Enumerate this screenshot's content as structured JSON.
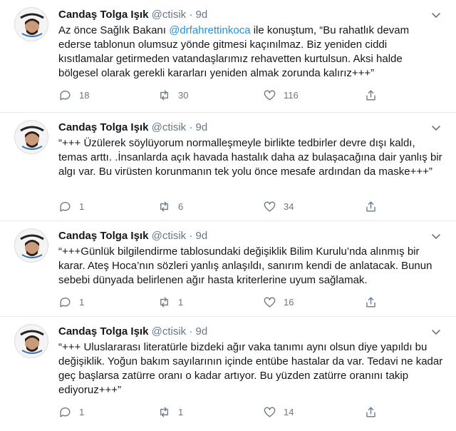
{
  "tweets": [
    {
      "author": "Candaş Tolga Işık",
      "handle": "@ctisik",
      "separator": "·",
      "time": "9d",
      "text_before": "Az önce Sağlık Bakanı ",
      "mention": "@drfahrettinkoca",
      "text_after": " ile konuştum, “Bu rahatlık devam ederse tablonun olumsuz yönde gitmesi kaçınılmaz. Biz yeniden ciddi kısıtlamalar getirmeden vatandaşlarımız rehavetten kurtulsun. Aksi halde bölgesel olarak gerekli kararları yeniden almak zorunda kalırız+++”",
      "replies": "18",
      "retweets": "30",
      "likes": "116"
    },
    {
      "author": "Candaş Tolga Işık",
      "handle": "@ctisik",
      "separator": "·",
      "time": "9d",
      "text_before": "“+++ Üzülerek söylüyorum normalleşmeyle birlikte tedbirler devre dışı kaldı, temas arttı. .İnsanlarda açık havada hastalık daha az bulaşacağına dair yanlış bir algı var. Bu virüsten korunmanın tek yolu önce mesafe ardından da maske+++”",
      "mention": "",
      "text_after": "",
      "replies": "1",
      "retweets": "6",
      "likes": "34"
    },
    {
      "author": "Candaş Tolga Işık",
      "handle": "@ctisik",
      "separator": "·",
      "time": "9d",
      "text_before": "“+++Günlük bilgilendirme tablosundaki değişiklik Bilim Kurulu’nda alınmış bir karar. Ateş Hoca’nın sözleri yanlış anlaşıldı, sanırım kendi de anlatacak. Bunun sebebi dünyada belirlenen ağır hasta kriterlerine uyum sağlamak.",
      "mention": "",
      "text_after": "",
      "replies": "1",
      "retweets": "1",
      "likes": "16"
    },
    {
      "author": "Candaş Tolga Işık",
      "handle": "@ctisik",
      "separator": "·",
      "time": "9d",
      "text_before": "“+++ Uluslararası literatürle bizdeki ağır vaka tanımı aynı olsun diye yapıldı bu değişiklik. Yoğun bakım sayılarının içinde entübe hastalar da var. Tedavi ne kadar geç başlarsa zatürre oranı o kadar artıyor. Bu yüzden zatürre oranını takip ediyoruz+++”",
      "mention": "",
      "text_after": "",
      "replies": "1",
      "retweets": "1",
      "likes": "14"
    }
  ],
  "colors": {
    "text": "#14171a",
    "meta": "#657786",
    "link": "#1b95e0",
    "border": "#e6ecf0"
  },
  "icons": {
    "reply": "reply-icon",
    "retweet": "retweet-icon",
    "like": "like-icon",
    "share": "share-icon",
    "menu": "chevron-down-icon"
  }
}
